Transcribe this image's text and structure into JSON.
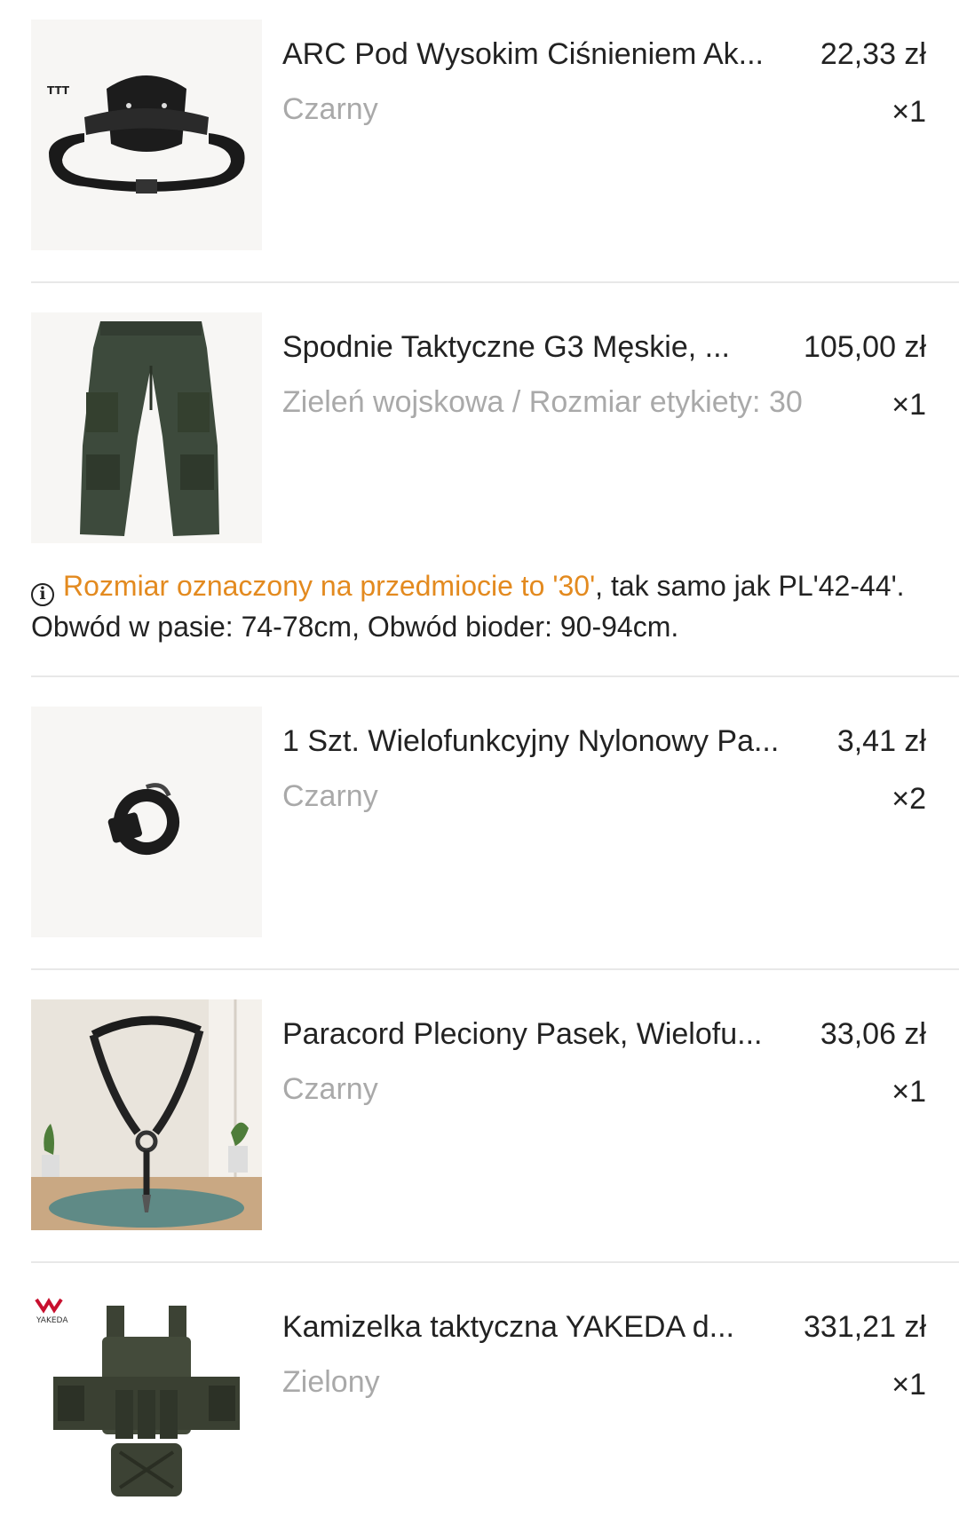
{
  "items": [
    {
      "title": "ARC Pod Wysokim Ciśnieniem Ak...",
      "price": "22,33 zł",
      "variant": "Czarny",
      "qty": "×1",
      "image_icon": "tactical-belt-image",
      "image_logo": "TTT"
    },
    {
      "title": "Spodnie Taktyczne G3 Męskie, ...",
      "price": "105,00 zł",
      "variant": "Zieleń wojskowa / Rozmiar etykiety: 30",
      "qty": "×1",
      "image_icon": "tactical-pants-image",
      "note": {
        "icon": "info-icon",
        "highlight": "Rozmiar oznaczony na przedmiocie to '30'",
        "text": ", tak samo jak PL'42-44'. Obwód w pasie: 74-78cm, Obwód bioder: 90-94cm."
      }
    },
    {
      "title": "1 Szt. Wielofunkcyjny Nylonowy Pa...",
      "price": "3,41 zł",
      "variant": "Czarny",
      "qty": "×2",
      "image_icon": "nylon-strap-image"
    },
    {
      "title": "Paracord Pleciony Pasek, Wielofu...",
      "price": "33,06 zł",
      "variant": "Czarny",
      "qty": "×1",
      "image_icon": "paracord-sling-image"
    },
    {
      "title": "Kamizelka taktyczna YAKEDA d...",
      "price": "331,21 zł",
      "variant": "Zielony",
      "qty": "×1",
      "image_icon": "tactical-vest-image",
      "image_logo": "YAKEDA"
    }
  ],
  "colors": {
    "highlight": "#e38a1f",
    "muted": "#a9a9a9",
    "text": "#222222",
    "divider": "#e8e8e8"
  }
}
